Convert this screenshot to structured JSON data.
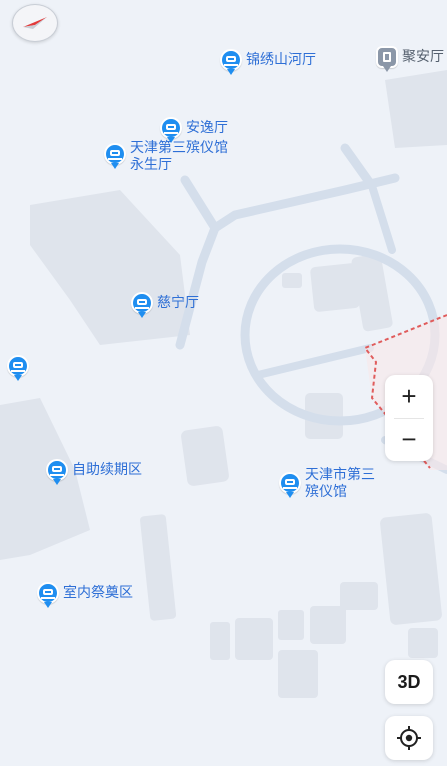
{
  "colors": {
    "background": "#eef2f8",
    "building": "#dfe4ec",
    "road": "#d4deeb",
    "poi_text": "#2e6fd6",
    "poi_pin": "#1f8ef0",
    "boundary": "#e05c5c"
  },
  "pois": [
    {
      "name": "锦绣山河厅",
      "icon": "bus-marker-icon"
    },
    {
      "name": "聚安厅",
      "icon": "building-marker-icon"
    },
    {
      "name": "安逸厅",
      "icon": "bus-marker-icon"
    },
    {
      "name": "天津第三殡仪馆\n永生厅",
      "icon": "bus-marker-icon"
    },
    {
      "name": "慈宁厅",
      "icon": "bus-marker-icon"
    },
    {
      "name": "",
      "icon": "bus-marker-icon"
    },
    {
      "name": "自助续期区",
      "icon": "bus-marker-icon"
    },
    {
      "name": "天津市第三\n殡仪馆",
      "icon": "bus-marker-icon"
    },
    {
      "name": "室内祭奠区",
      "icon": "bus-marker-icon"
    }
  ],
  "controls": {
    "zoom_in": "+",
    "zoom_out": "−",
    "three_d": "3D",
    "compass_icon": "compass-icon",
    "locate_icon": "locate-icon"
  }
}
